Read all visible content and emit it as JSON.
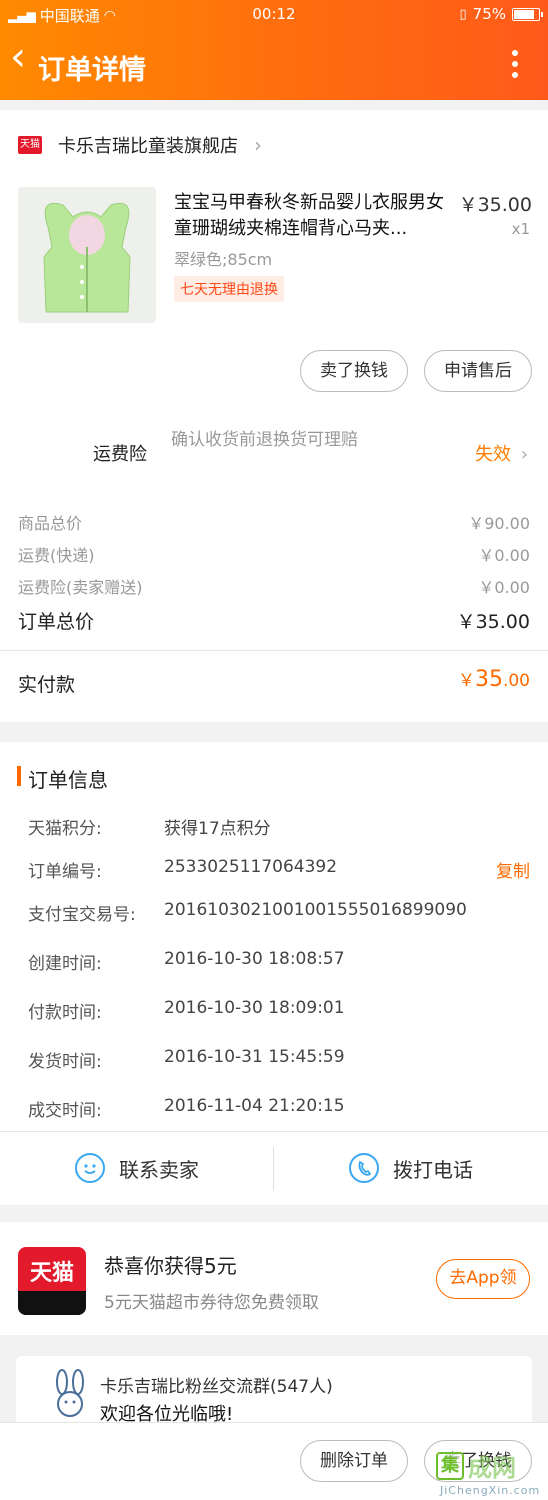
{
  "status": {
    "carrier": "中国联通",
    "time": "00:12",
    "battery": "75%",
    "battery_level": 0.75
  },
  "nav": {
    "back_glyph": "‹",
    "title": "订单详情"
  },
  "shop": {
    "badge": "天猫",
    "name": "卡乐吉瑞比童装旗舰店"
  },
  "product": {
    "title": "宝宝马甲春秋冬新品婴儿衣服男女童珊瑚绒夹棉连帽背心马夹...",
    "price": "￥35.00",
    "quantity": "x1",
    "sku": "翠绿色;85cm",
    "tag": "七天无理由退换"
  },
  "actions": {
    "sell": "卖了换钱",
    "after_sale": "申请售后"
  },
  "insurance": {
    "label": "运费险",
    "desc": "确认收货前退换货可理赔",
    "status": "失效"
  },
  "summary": [
    {
      "label": "商品总价",
      "value": "￥90.00"
    },
    {
      "label": "运费(快递)",
      "value": "￥0.00"
    },
    {
      "label": "运费险(卖家赠送)",
      "value": "￥0.00"
    },
    {
      "label": "订单总价",
      "value": "￥35.00"
    }
  ],
  "paid": {
    "label": "实付款",
    "currency": "￥",
    "integer": "35",
    "decimal": ".00"
  },
  "order_info": {
    "title": "订单信息",
    "rows": [
      {
        "label": "天猫积分:",
        "value": "获得17点积分"
      },
      {
        "label": "订单编号:",
        "value": "2533025117064392"
      },
      {
        "label": "支付宝交易号:",
        "value": "2016103021001001555016899090"
      },
      {
        "label": "创建时间:",
        "value": "2016-10-30 18:08:57"
      },
      {
        "label": "付款时间:",
        "value": "2016-10-30 18:09:01"
      },
      {
        "label": "发货时间:",
        "value": "2016-10-31 15:45:59"
      },
      {
        "label": "成交时间:",
        "value": "2016-11-04 21:20:15"
      }
    ],
    "copy": "复制",
    "contact_seller": "联系卖家",
    "call_phone": "拨打电话"
  },
  "promo": {
    "logo_text": "天猫",
    "title": "恭喜你获得5元",
    "subtitle": "5元天猫超市券待您免费领取",
    "button": "去App领"
  },
  "fan_group": {
    "name": "卡乐吉瑞比粉丝交流群(547人)",
    "message": "欢迎各位光临哦!"
  },
  "bottom": {
    "delete": "删除订单",
    "sell": "卖了换钱"
  },
  "watermark": {
    "box_char": "集",
    "text": "成网",
    "url": "JiChengXin.com"
  },
  "colors": {
    "accent": "#ff6a00",
    "brand_red": "#e21a2b"
  }
}
